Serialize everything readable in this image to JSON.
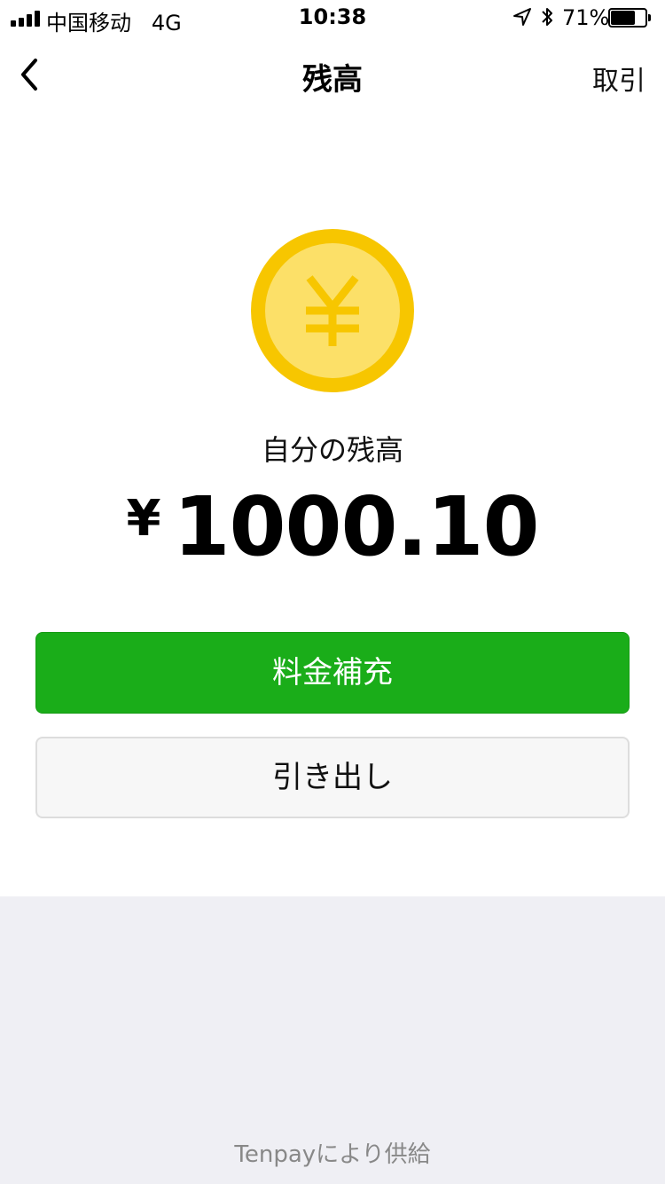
{
  "status_bar": {
    "carrier": "中国移动",
    "network": "4G",
    "time": "10:38",
    "battery_percent": "71%",
    "battery_level": 0.71
  },
  "nav": {
    "title": "残高",
    "right_action": "取引",
    "back_icon": "chevron-left-icon"
  },
  "balance": {
    "coin_icon": "yen-coin-icon",
    "label": "自分の残高",
    "currency": "¥",
    "amount": "1000.10"
  },
  "buttons": {
    "topup": "料金補充",
    "withdraw": "引き出し"
  },
  "footer": {
    "powered_by": "Tenpayにより供給"
  },
  "colors": {
    "primary_green": "#1AAD19",
    "coin_outer": "#F7C600",
    "coin_inner": "#FCE068",
    "background_gray": "#EFEFF4"
  }
}
